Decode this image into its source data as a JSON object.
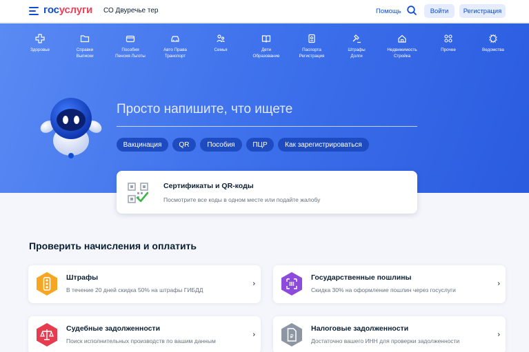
{
  "header": {
    "logo_part1": "гос",
    "logo_part2": "услуги",
    "region": "СО Двуречье тер",
    "help": "Помощь",
    "login": "Войти",
    "register": "Регистрация"
  },
  "categories": [
    {
      "label": "Здоровье",
      "icon": "health-icon"
    },
    {
      "label": "Справки\nВыписки",
      "icon": "folder-icon"
    },
    {
      "label": "Пособия\nПенсия Льготы",
      "icon": "wallet-icon"
    },
    {
      "label": "Авто Права\nТранспорт",
      "icon": "car-icon"
    },
    {
      "label": "Семья",
      "icon": "family-icon"
    },
    {
      "label": "Дети\nОбразование",
      "icon": "book-icon"
    },
    {
      "label": "Паспорта\nРегистрация",
      "icon": "passport-icon"
    },
    {
      "label": "Штрафы\nДолги",
      "icon": "gavel-icon"
    },
    {
      "label": "Недвижимость\nСтройка",
      "icon": "house-icon"
    },
    {
      "label": "Прочее",
      "icon": "grid-icon"
    },
    {
      "label": "Ведомства",
      "icon": "emblem-icon"
    }
  ],
  "hero": {
    "query": "Просто напишите, что ищете",
    "chips": [
      "Вакцинация",
      "QR",
      "Пособия",
      "ПЦР",
      "Как зарегистрироваться"
    ]
  },
  "cert_card": {
    "title": "Сертификаты и QR-коды",
    "subtitle": "Посмотрите все коды в одном месте или подайте жалобу"
  },
  "payments": {
    "title": "Проверить начисления и оплатить",
    "items": [
      {
        "title": "Штрафы",
        "subtitle": "В течение 20 дней скидка 50% на штрафы ГИБДД",
        "icon": "traffic-light-icon",
        "color": "#f5a623"
      },
      {
        "title": "Государственные пошлины",
        "subtitle": "Скидка 30% на оформление пошлин через госуслуги",
        "icon": "receipt-icon",
        "color": "#8d4bdb"
      },
      {
        "title": "Судебные задолженности",
        "subtitle": "Поиск исполнительных производств по вашим данным",
        "icon": "scales-icon",
        "color": "#e53d4f"
      },
      {
        "title": "Налоговые задолженности",
        "subtitle": "Достаточно вашего ИНН для проверки задолженности",
        "icon": "tax-document-icon",
        "color": "#8f96a3"
      }
    ]
  },
  "colors": {
    "brand_blue": "#0d4cd3",
    "brand_red": "#ee3f58",
    "chip_bg": "#1e4bbf"
  }
}
